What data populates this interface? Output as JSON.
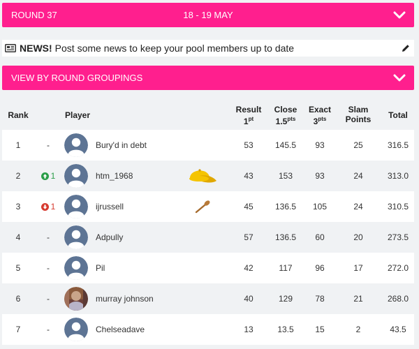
{
  "round": {
    "label": "ROUND 37",
    "dates": "18 - 19 MAY"
  },
  "news": {
    "label": "NEWS!",
    "text": "Post some news to keep your pool members up to date"
  },
  "groupings": {
    "label": "VIEW BY ROUND GROUPINGS"
  },
  "colors": {
    "accent": "#ff1f8e",
    "up": "#2a9d48",
    "down": "#d63a2f"
  },
  "table": {
    "headers": {
      "rank": "Rank",
      "player": "Player",
      "result": "Result",
      "result_pts": "1",
      "result_pts_sup": "pt",
      "close": "Close",
      "close_pts": "1.5",
      "close_pts_sup": "pts",
      "exact": "Exact",
      "exact_pts": "3",
      "exact_pts_sup": "pts",
      "slam_line1": "Slam",
      "slam_line2": "Points",
      "total": "Total"
    },
    "rows": [
      {
        "rank": "1",
        "move": "-",
        "move_dir": "none",
        "name": "Bury'd in debt",
        "avatar": "default",
        "badge": "",
        "result": "53",
        "close": "145.5",
        "exact": "93",
        "slam": "25",
        "total": "316.5"
      },
      {
        "rank": "2",
        "move": "1",
        "move_dir": "up",
        "name": "htm_1968",
        "avatar": "default",
        "badge": "cap-icon",
        "result": "43",
        "close": "153",
        "exact": "93",
        "slam": "24",
        "total": "313.0"
      },
      {
        "rank": "3",
        "move": "1",
        "move_dir": "down",
        "name": "ijrussell",
        "avatar": "default",
        "badge": "wooden-spoon-icon",
        "result": "45",
        "close": "136.5",
        "exact": "105",
        "slam": "24",
        "total": "310.5"
      },
      {
        "rank": "4",
        "move": "-",
        "move_dir": "none",
        "name": "Adpully",
        "avatar": "default",
        "badge": "",
        "result": "57",
        "close": "136.5",
        "exact": "60",
        "slam": "20",
        "total": "273.5"
      },
      {
        "rank": "5",
        "move": "-",
        "move_dir": "none",
        "name": "Pil",
        "avatar": "default",
        "badge": "",
        "result": "42",
        "close": "117",
        "exact": "96",
        "slam": "17",
        "total": "272.0"
      },
      {
        "rank": "6",
        "move": "-",
        "move_dir": "none",
        "name": "murray johnson",
        "avatar": "photo",
        "badge": "",
        "result": "40",
        "close": "129",
        "exact": "78",
        "slam": "21",
        "total": "268.0"
      },
      {
        "rank": "7",
        "move": "-",
        "move_dir": "none",
        "name": "Chelseadave",
        "avatar": "default",
        "badge": "",
        "result": "13",
        "close": "13.5",
        "exact": "15",
        "slam": "2",
        "total": "43.5"
      }
    ]
  }
}
